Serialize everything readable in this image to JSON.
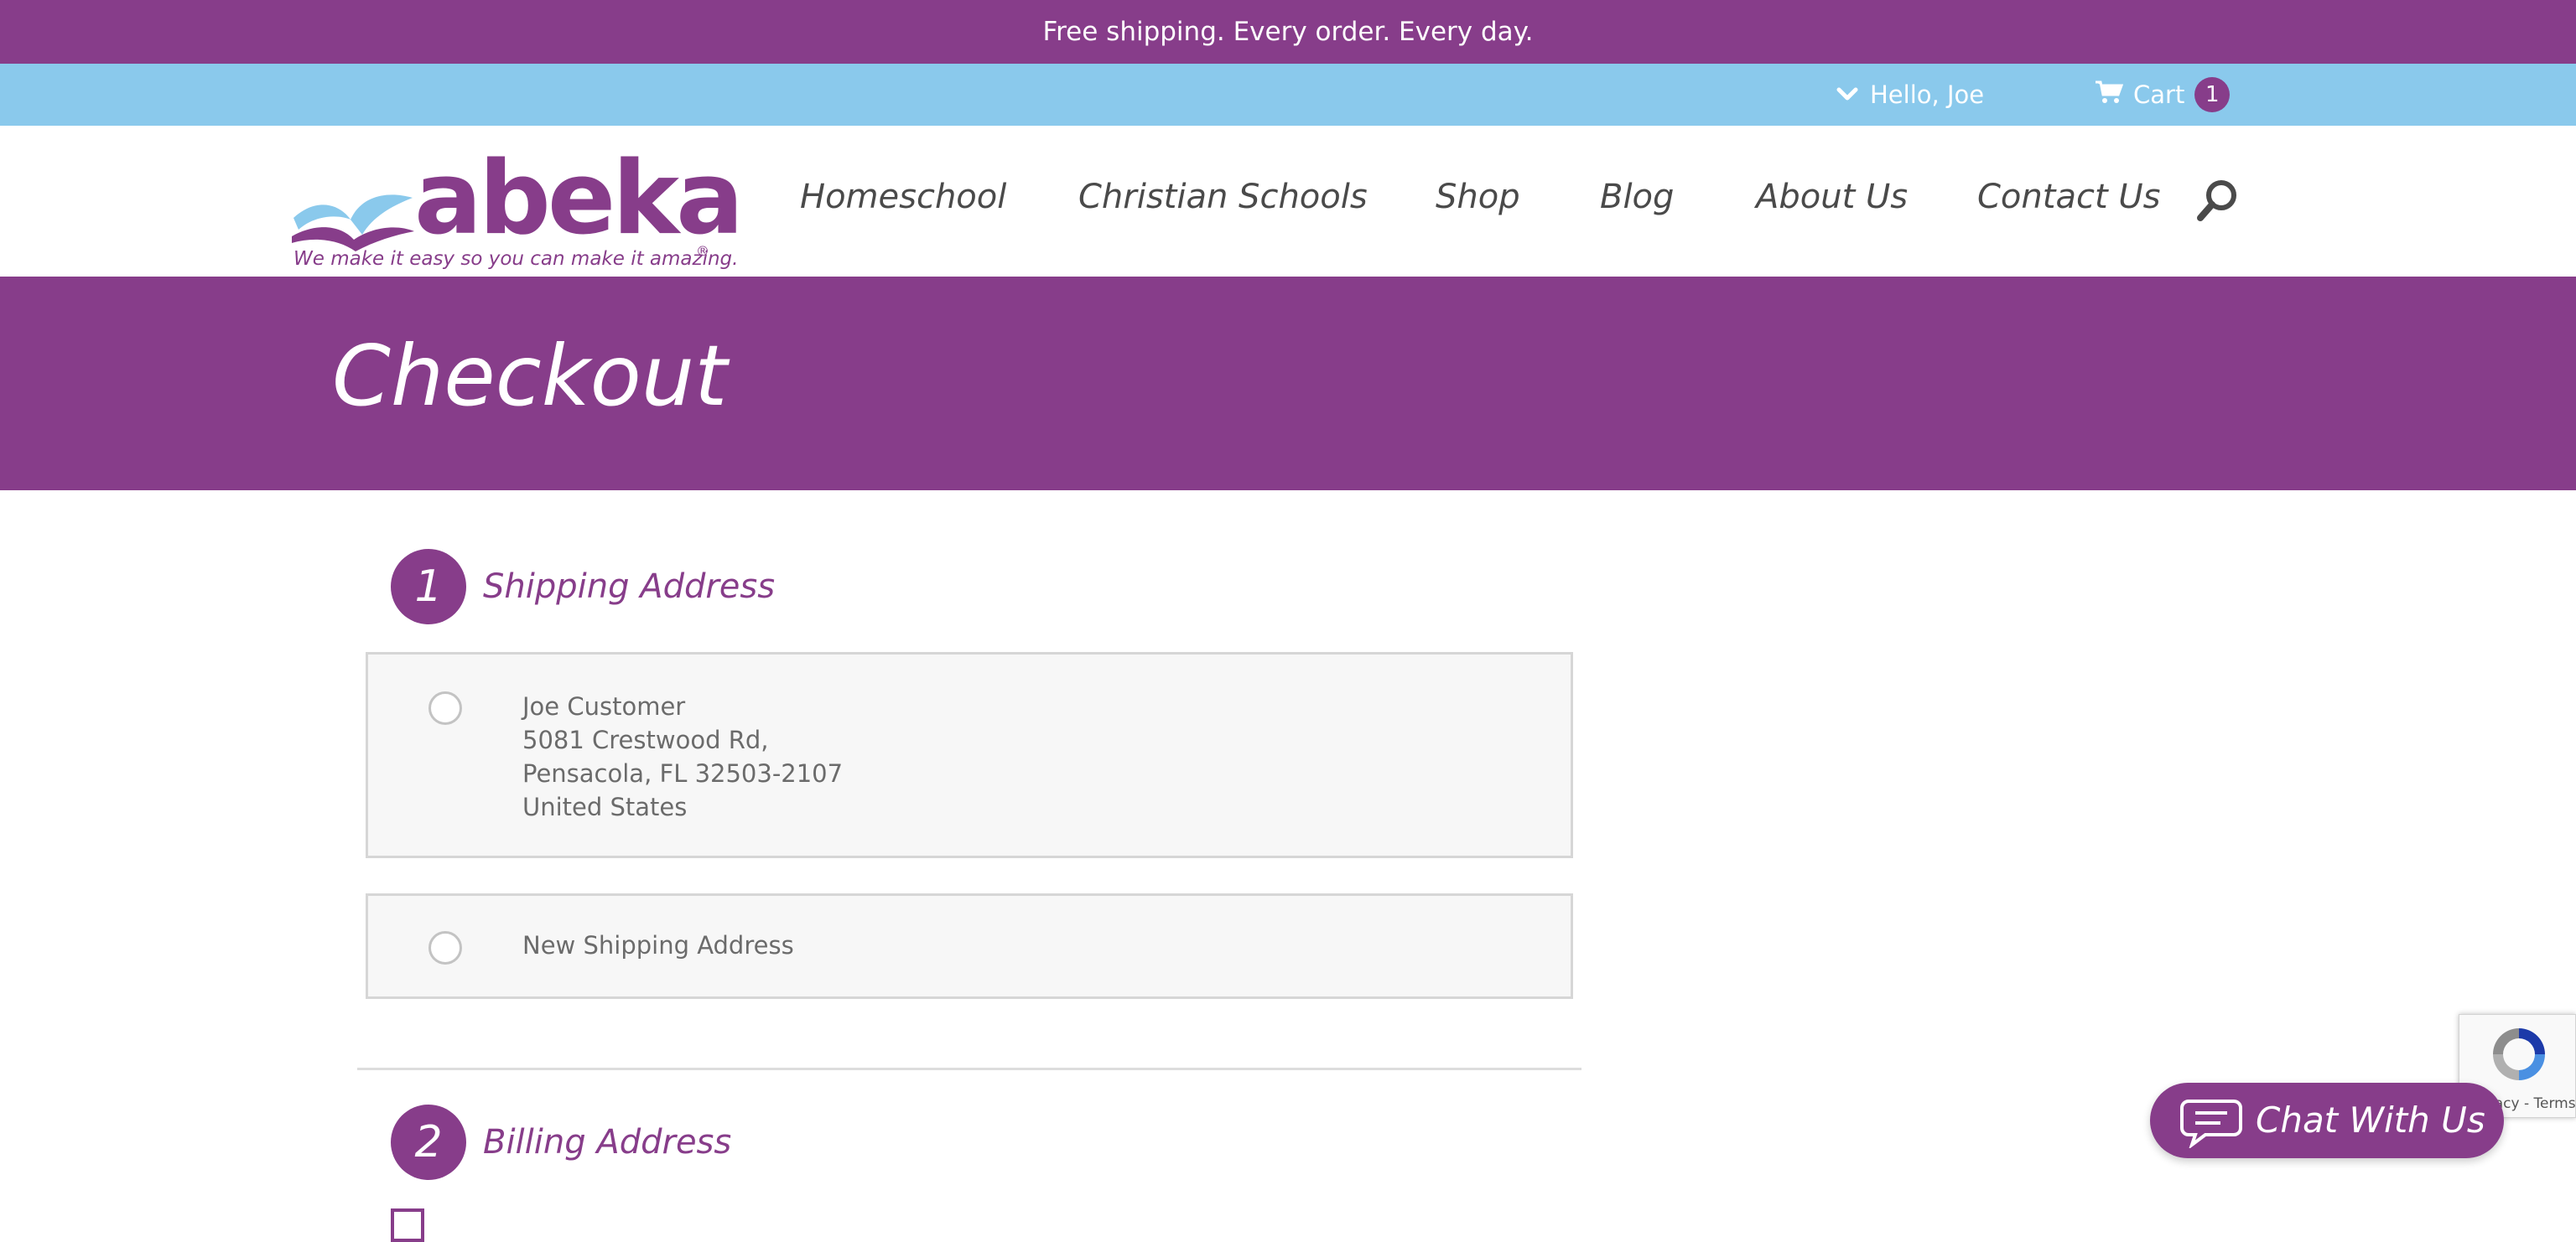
{
  "promo_bar": {
    "text": "Free shipping. Every order. Every day."
  },
  "utility_bar": {
    "account_label": "Hello, Joe",
    "cart_label": "Cart",
    "cart_count": "1"
  },
  "header": {
    "logo_text": "abeka",
    "logo_reg": "®",
    "tagline": "We make it easy so you can make it amazing.",
    "nav": [
      {
        "label": "Homeschool"
      },
      {
        "label": "Christian Schools"
      },
      {
        "label": "Shop"
      },
      {
        "label": "Blog"
      },
      {
        "label": "About Us"
      },
      {
        "label": "Contact Us"
      }
    ],
    "search_icon": "search-icon"
  },
  "hero": {
    "title": "Checkout"
  },
  "checkout": {
    "shipping": {
      "step_number": "1",
      "title": "Shipping Address",
      "saved_address": {
        "name": "Joe Customer",
        "street": "5081 Crestwood Rd,",
        "city_state_zip": "Pensacola, FL 32503-2107",
        "country": "United States"
      },
      "new_address_label": "New Shipping Address"
    },
    "billing": {
      "step_number": "2",
      "title": "Billing Address"
    }
  },
  "recaptcha": {
    "footer": "Privacy - Terms"
  },
  "chat": {
    "label": "Chat With Us"
  },
  "colors": {
    "brand_purple": "#873d8a",
    "utility_blue": "#8ac9ec"
  }
}
